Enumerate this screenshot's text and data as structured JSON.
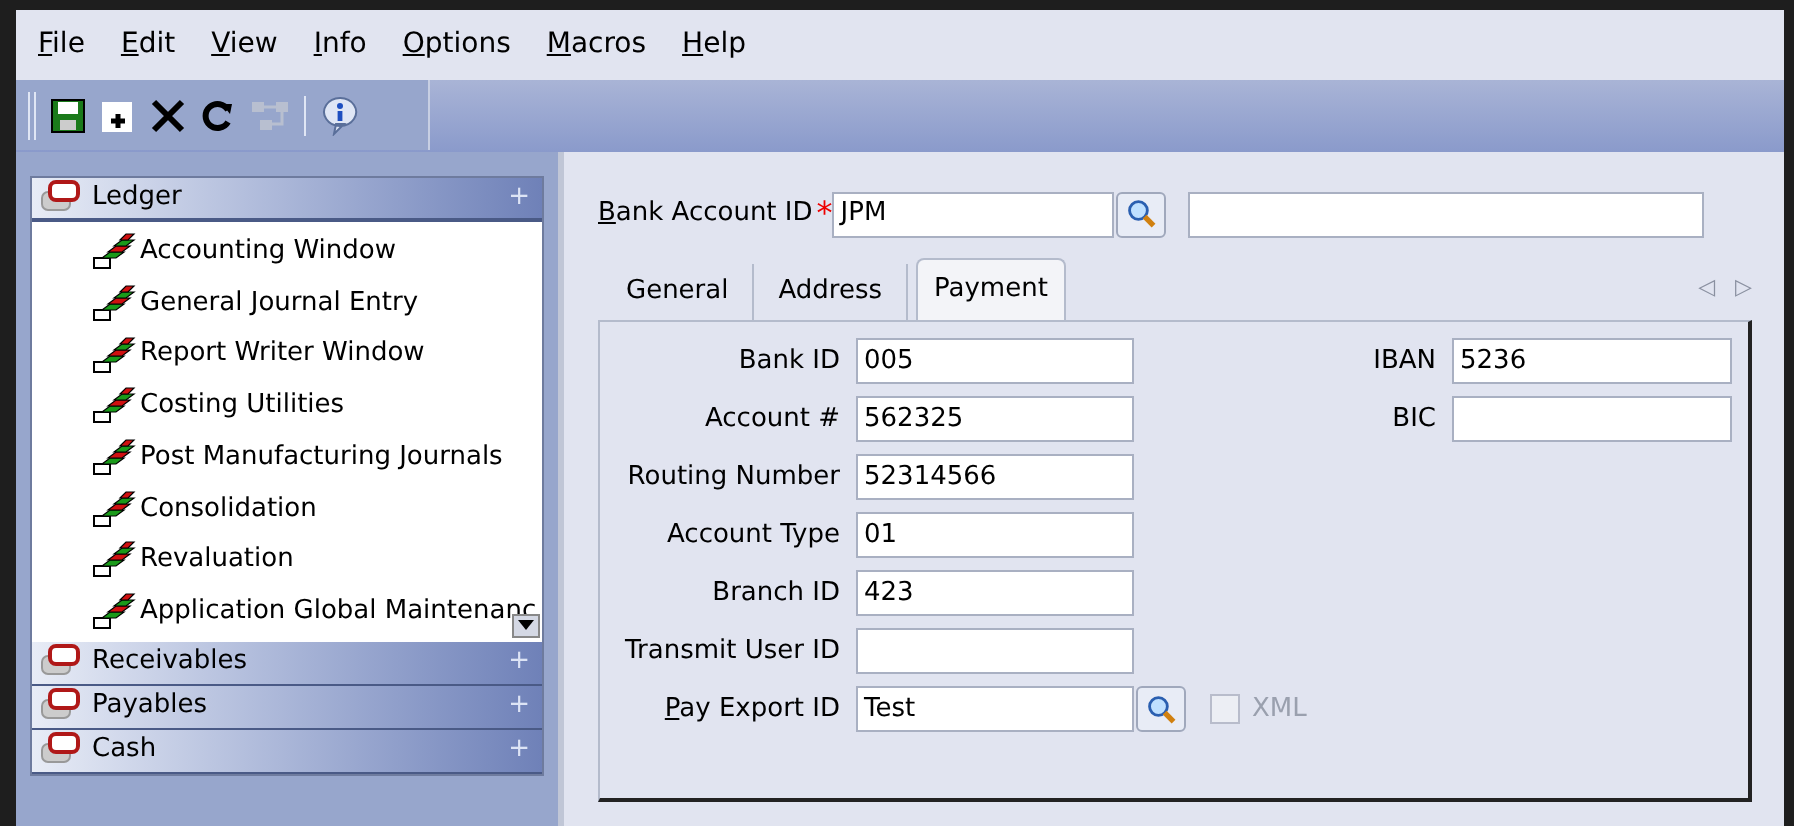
{
  "menu": [
    "File",
    "Edit",
    "View",
    "Info",
    "Options",
    "Macros",
    "Help"
  ],
  "toolbar": [
    {
      "kind": "save",
      "disabled": false
    },
    {
      "kind": "new",
      "disabled": false
    },
    {
      "kind": "delete",
      "disabled": false
    },
    {
      "kind": "refresh",
      "disabled": false
    },
    {
      "kind": "link",
      "disabled": true
    },
    {
      "kind": "info",
      "disabled": false
    }
  ],
  "sidebar": [
    {
      "label": "Ledger",
      "expander": "+",
      "expanded": true,
      "children": [
        {
          "label": "Accounting Window"
        },
        {
          "label": "General Journal Entry"
        },
        {
          "label": "Report Writer Window"
        },
        {
          "label": "Costing Utilities"
        },
        {
          "label": "Post Manufacturing Journals"
        },
        {
          "label": "Consolidation"
        },
        {
          "label": "Revaluation"
        },
        {
          "label": "Application Global Maintenanc"
        }
      ]
    },
    {
      "label": "Receivables",
      "expander": "+",
      "expanded": false
    },
    {
      "label": "Payables",
      "expander": "+",
      "expanded": false
    },
    {
      "label": "Cash",
      "expander": "+",
      "expanded": false
    }
  ],
  "header": {
    "label": "Bank Account ID",
    "required_mark": "*",
    "value": "JPM"
  },
  "tabs": [
    {
      "label": "General",
      "selected": false
    },
    {
      "label": "Address",
      "selected": false
    },
    {
      "label": "Payment",
      "selected": true
    }
  ],
  "tab_scroll": [
    "◁",
    "▷"
  ],
  "left_fields": [
    {
      "label": "Bank ID",
      "value": "005",
      "lookup": false
    },
    {
      "label": "Account #",
      "value": "562325",
      "lookup": false
    },
    {
      "label": "Routing Number",
      "value": "52314566",
      "lookup": false
    },
    {
      "label": "Account Type",
      "value": "01",
      "lookup": false
    },
    {
      "label": "Branch ID",
      "value": "423",
      "lookup": false
    },
    {
      "label": "Transmit User ID",
      "lookup": false
    },
    {
      "label": "Pay Export ID",
      "value": "Test",
      "lookup": true
    }
  ],
  "right_fields": [
    {
      "label": "IBAN",
      "value": "5236"
    },
    {
      "label": "BIC"
    }
  ],
  "xml_checkbox": {
    "label": "XML",
    "checked": false,
    "disabled": true
  }
}
